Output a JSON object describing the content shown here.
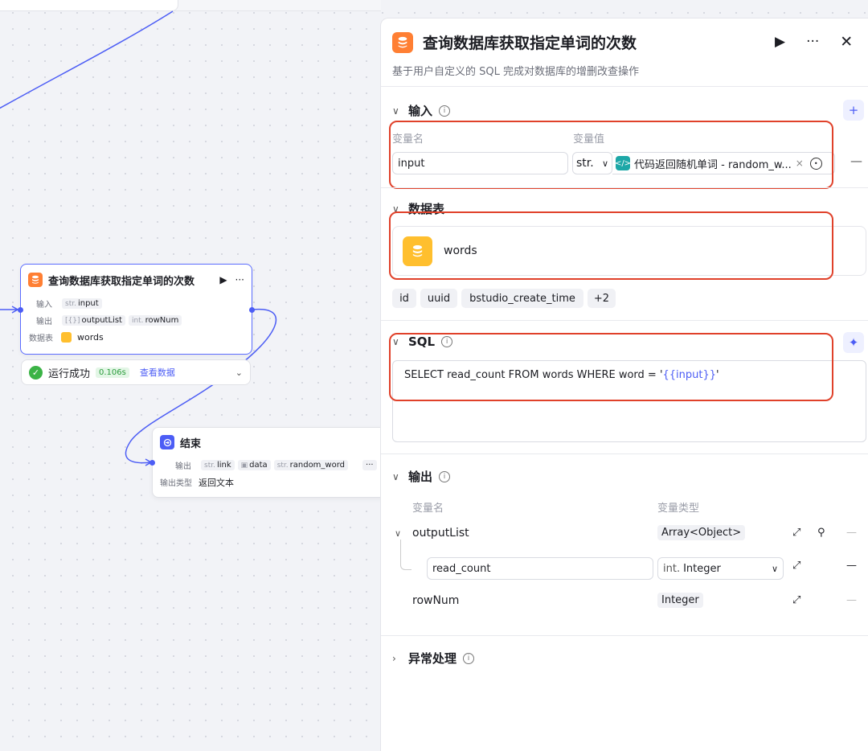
{
  "canvas": {
    "db_node": {
      "title": "查询数据库获取指定单词的次数",
      "input_label": "输入",
      "input_type": "str.",
      "input_name": "input",
      "output_label": "输出",
      "output1_type": "[{}]",
      "output1_name": "outputList",
      "output2_type": "int.",
      "output2_name": "rowNum",
      "table_label": "数据表",
      "table_name": "words"
    },
    "run_status": {
      "text": "运行成功",
      "time": "0.106s",
      "view": "查看数据"
    },
    "end_node": {
      "title": "结束",
      "output_label": "输出",
      "tag1_type": "str.",
      "tag1_name": "link",
      "tag2_name": "data",
      "tag3_type": "str.",
      "tag3_name": "random_word",
      "type_label": "输出类型",
      "type_value": "返回文本"
    }
  },
  "panel": {
    "title": "查询数据库获取指定单词的次数",
    "description": "基于用户自定义的 SQL 完成对数据库的增删改查操作",
    "input_section": {
      "title": "输入",
      "col_name": "变量名",
      "col_value": "变量值",
      "var_name": "input",
      "type": "str.",
      "ref_value": "代码返回随机单词 - random_w..."
    },
    "table_section": {
      "title": "数据表",
      "table_name": "words",
      "fields": [
        "id",
        "uuid",
        "bstudio_create_time",
        "+2"
      ]
    },
    "sql_section": {
      "title": "SQL",
      "query_prefix": "SELECT read_count FROM words WHERE word = '",
      "query_var": "{{input}}",
      "query_suffix": "'"
    },
    "output_section": {
      "title": "输出",
      "col_name": "变量名",
      "col_type": "变量类型",
      "rows": [
        {
          "name": "outputList",
          "type": "Array<Object>"
        },
        {
          "name": "read_count",
          "type_prefix": "int.",
          "type": "Integer"
        },
        {
          "name": "rowNum",
          "type": "Integer"
        }
      ]
    },
    "error_section": {
      "title": "异常处理"
    }
  },
  "colors": {
    "accent": "#4c5df5",
    "highlight": "#e0412a",
    "db_orange": "#ff7f33",
    "table_yellow": "#ffbf2e",
    "success": "#3bb346"
  }
}
